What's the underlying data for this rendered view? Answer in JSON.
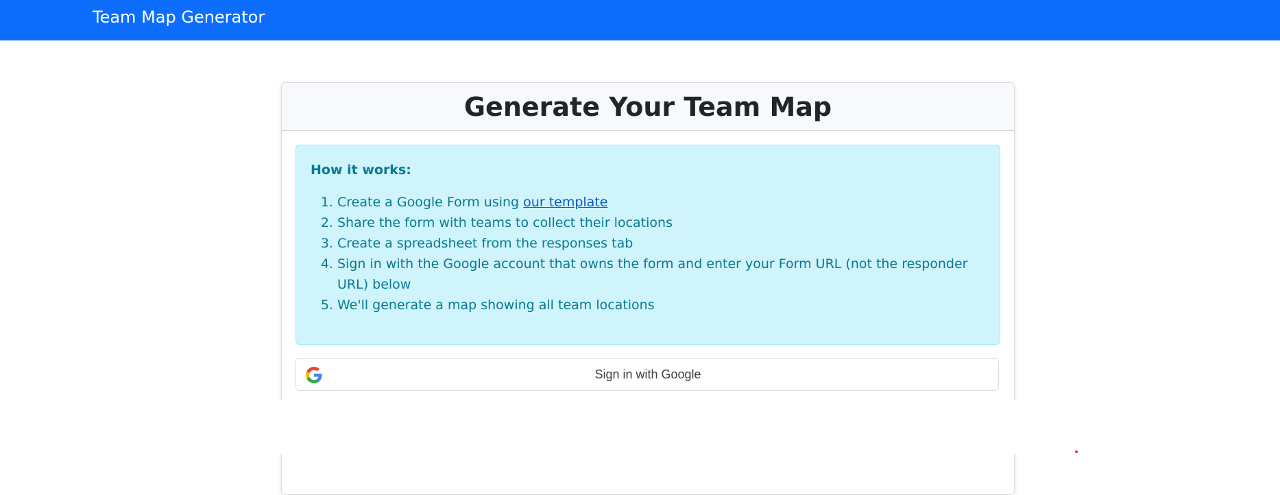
{
  "navbar": {
    "brand": "Team Map Generator"
  },
  "card": {
    "title": "Generate Your Team Map",
    "info": {
      "heading": "How it works:",
      "steps": [
        {
          "text": "Create a Google Form using ",
          "link": "our template"
        },
        {
          "text": "Share the form with teams to collect their locations"
        },
        {
          "text": "Create a spreadsheet from the responses tab"
        },
        {
          "text": "Sign in with the Google account that owns the form and enter your Form URL (not the responder URL) below"
        },
        {
          "text": "We'll generate a map showing all team locations"
        }
      ]
    },
    "signin_button": {
      "label": "Sign in with Google",
      "icon": "google-g-icon"
    }
  },
  "colors": {
    "navbar": "#0d6efd",
    "info_background": "#cff4fc",
    "info_text": "#087990",
    "link": "#0a58ca"
  }
}
